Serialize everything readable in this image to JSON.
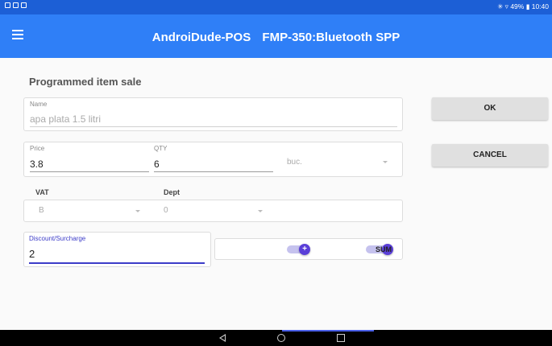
{
  "status_bar": {
    "time_text": "✳ ▿ 49% ▮ 10:40"
  },
  "app_bar": {
    "app_name": "AndroiDude-POS",
    "device": "FMP-350:Bluetooth SPP",
    "accent_color": "#2f7ff7"
  },
  "form": {
    "title": "Programmed item sale",
    "name": {
      "label": "Name",
      "value": "apa plata 1.5 litri"
    },
    "price": {
      "label": "Price",
      "value": "3.8"
    },
    "qty": {
      "label": "QTY",
      "value": "6"
    },
    "unit": {
      "value": "buc."
    },
    "vat": {
      "label": "VAT",
      "value": "B"
    },
    "dept": {
      "label": "Dept",
      "value": "0"
    },
    "discount": {
      "label": "Discount/Surcharge",
      "value": "2"
    },
    "sign_toggle": {
      "label": "+"
    },
    "sum_toggle": {
      "label": "SUM"
    }
  },
  "buttons": {
    "ok": "OK",
    "cancel": "CANCEL"
  },
  "nav": {
    "back_icon": "back-icon",
    "home_icon": "home-icon",
    "recent_icon": "recent-apps-icon"
  }
}
